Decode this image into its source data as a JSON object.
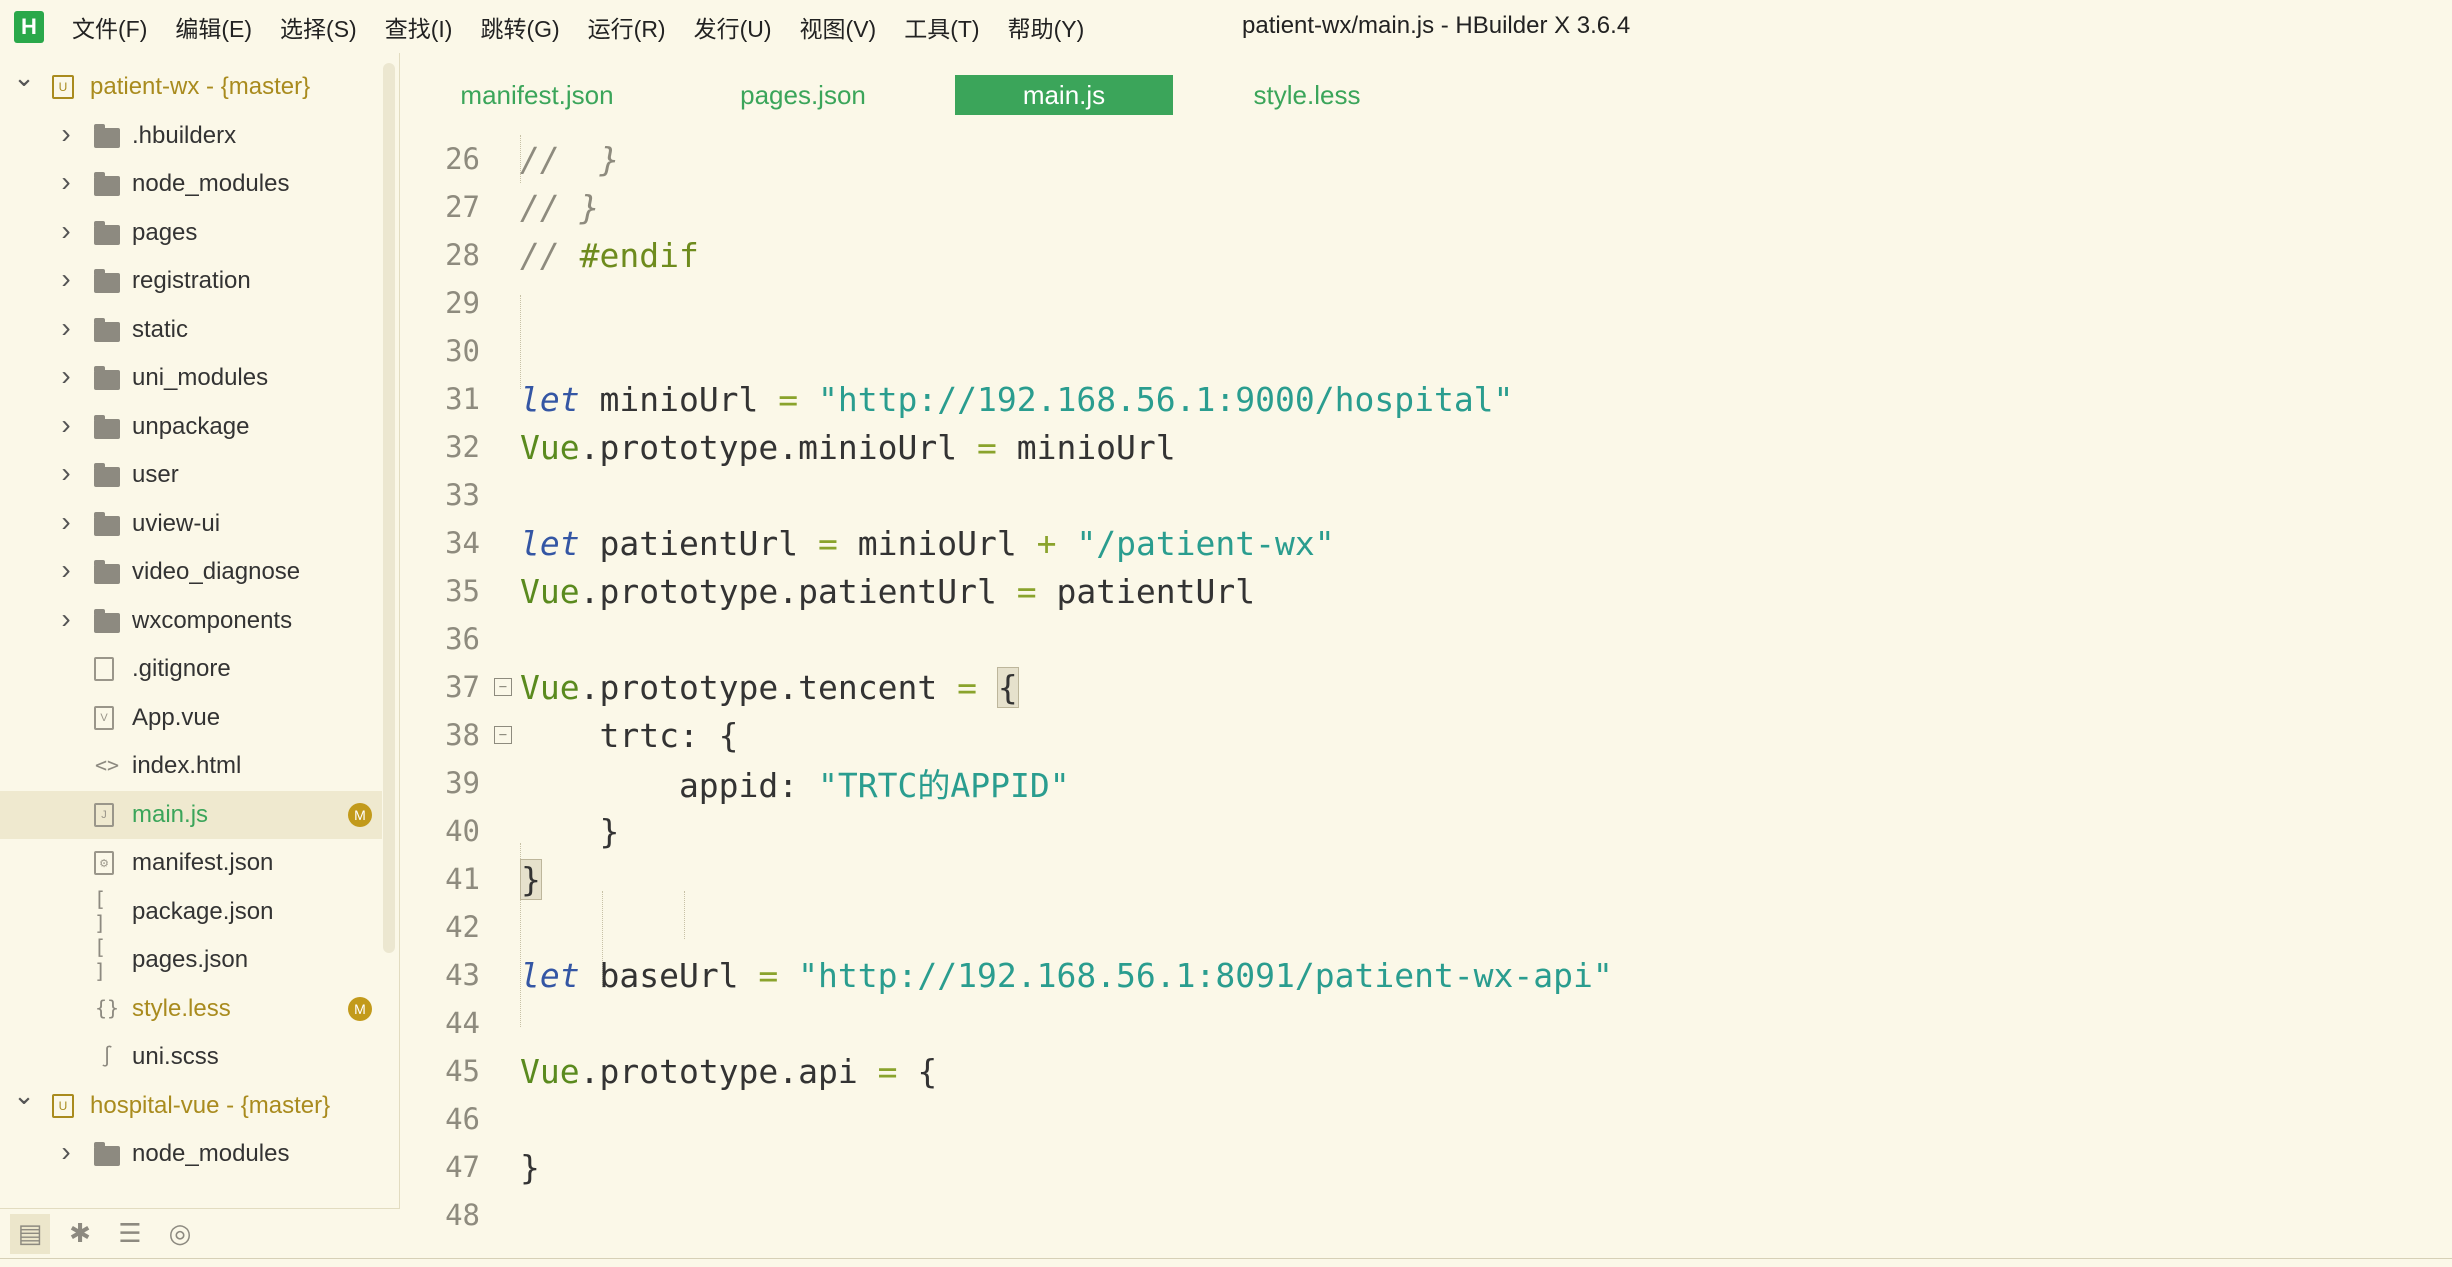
{
  "app": {
    "logo_letter": "H",
    "window_title": "patient-wx/main.js - HBuilder X 3.6.4"
  },
  "menu": [
    "文件(F)",
    "编辑(E)",
    "选择(S)",
    "查找(I)",
    "跳转(G)",
    "运行(R)",
    "发行(U)",
    "视图(V)",
    "工具(T)",
    "帮助(Y)"
  ],
  "sidebar": {
    "items": [
      {
        "label": "patient-wx - {master}",
        "kind": "project",
        "expanded": true
      },
      {
        "label": ".hbuilderx",
        "kind": "folder"
      },
      {
        "label": "node_modules",
        "kind": "folder"
      },
      {
        "label": "pages",
        "kind": "folder"
      },
      {
        "label": "registration",
        "kind": "folder"
      },
      {
        "label": "static",
        "kind": "folder"
      },
      {
        "label": "uni_modules",
        "kind": "folder"
      },
      {
        "label": "unpackage",
        "kind": "folder"
      },
      {
        "label": "user",
        "kind": "folder"
      },
      {
        "label": "uview-ui",
        "kind": "folder"
      },
      {
        "label": "video_diagnose",
        "kind": "folder"
      },
      {
        "label": "wxcomponents",
        "kind": "folder"
      },
      {
        "label": ".gitignore",
        "kind": "file",
        "icon": "blank-file-icon"
      },
      {
        "label": "App.vue",
        "kind": "file",
        "icon": "vue-file-icon"
      },
      {
        "label": "index.html",
        "kind": "file",
        "icon": "html-file-icon"
      },
      {
        "label": "main.js",
        "kind": "file",
        "icon": "js-file-icon",
        "badge": "M",
        "selected": true
      },
      {
        "label": "manifest.json",
        "kind": "file",
        "icon": "gear-file-icon"
      },
      {
        "label": "package.json",
        "kind": "file",
        "icon": "bracket-file-icon"
      },
      {
        "label": "pages.json",
        "kind": "file",
        "icon": "bracket-file-icon"
      },
      {
        "label": "style.less",
        "kind": "file",
        "icon": "braces-file-icon",
        "badge": "M"
      },
      {
        "label": "uni.scss",
        "kind": "file",
        "icon": "sass-file-icon"
      },
      {
        "label": "hospital-vue - {master}",
        "kind": "project",
        "expanded": true
      },
      {
        "label": "node_modules",
        "kind": "folder"
      }
    ]
  },
  "tabs": [
    {
      "label": "manifest.json",
      "active": false
    },
    {
      "label": "pages.json",
      "active": false
    },
    {
      "label": "main.js",
      "active": true
    },
    {
      "label": "style.less",
      "active": false
    }
  ],
  "editor": {
    "lines": [
      {
        "n": "26",
        "tokens": [
          [
            "comment",
            "//  }"
          ]
        ]
      },
      {
        "n": "27",
        "tokens": [
          [
            "comment",
            "// }"
          ]
        ]
      },
      {
        "n": "28",
        "tokens": [
          [
            "comment",
            "// "
          ],
          [
            "directive",
            "#endif"
          ]
        ]
      },
      {
        "n": "29",
        "tokens": []
      },
      {
        "n": "30",
        "tokens": []
      },
      {
        "n": "31",
        "tokens": [
          [
            "kw",
            "let"
          ],
          [
            "ident",
            " minioUrl "
          ],
          [
            "op",
            "="
          ],
          [
            "ident",
            " "
          ],
          [
            "str",
            "\"http://192.168.56.1:9000/hospital\""
          ]
        ]
      },
      {
        "n": "32",
        "tokens": [
          [
            "obj",
            "Vue"
          ],
          [
            "ident",
            ".prototype.minioUrl "
          ],
          [
            "op",
            "="
          ],
          [
            "ident",
            " minioUrl"
          ]
        ]
      },
      {
        "n": "33",
        "tokens": []
      },
      {
        "n": "34",
        "tokens": [
          [
            "kw",
            "let"
          ],
          [
            "ident",
            " patientUrl "
          ],
          [
            "op",
            "="
          ],
          [
            "ident",
            " minioUrl "
          ],
          [
            "op",
            "+"
          ],
          [
            "ident",
            " "
          ],
          [
            "str",
            "\"/patient-wx\""
          ]
        ]
      },
      {
        "n": "35",
        "tokens": [
          [
            "obj",
            "Vue"
          ],
          [
            "ident",
            ".prototype.patientUrl "
          ],
          [
            "op",
            "="
          ],
          [
            "ident",
            " patientUrl"
          ]
        ]
      },
      {
        "n": "36",
        "tokens": []
      },
      {
        "n": "37",
        "tokens": [
          [
            "obj",
            "Vue"
          ],
          [
            "ident",
            ".prototype.tencent "
          ],
          [
            "op",
            "="
          ],
          [
            "ident",
            " "
          ],
          [
            "bracehl",
            "{"
          ]
        ],
        "fold": true
      },
      {
        "n": "38",
        "tokens": [
          [
            "ident",
            "    trtc: {"
          ]
        ],
        "fold": true
      },
      {
        "n": "39",
        "tokens": [
          [
            "ident",
            "        appid: "
          ],
          [
            "str",
            "\"TRTC的APPID\""
          ]
        ]
      },
      {
        "n": "40",
        "tokens": [
          [
            "ident",
            "    }"
          ]
        ]
      },
      {
        "n": "41",
        "tokens": [
          [
            "bracehl",
            "}"
          ]
        ]
      },
      {
        "n": "42",
        "tokens": []
      },
      {
        "n": "43",
        "tokens": [
          [
            "kw",
            "let"
          ],
          [
            "ident",
            " baseUrl "
          ],
          [
            "op",
            "="
          ],
          [
            "ident",
            " "
          ],
          [
            "str",
            "\"http://192.168.56.1:8091/patient-wx-api\""
          ]
        ]
      },
      {
        "n": "44",
        "tokens": []
      },
      {
        "n": "45",
        "tokens": [
          [
            "obj",
            "Vue"
          ],
          [
            "ident",
            ".prototype.api "
          ],
          [
            "op",
            "="
          ],
          [
            "ident",
            " {"
          ]
        ]
      },
      {
        "n": "46",
        "tokens": []
      },
      {
        "n": "47",
        "tokens": [
          [
            "ident",
            "}"
          ]
        ]
      },
      {
        "n": "48",
        "tokens": []
      }
    ]
  },
  "bottom_toolbar": [
    "explorer-icon",
    "debug-icon",
    "search-list-icon",
    "globe-icon"
  ],
  "colors": {
    "background": "#fbf8e8",
    "accent_green": "#3ba55a",
    "project_gold": "#a98b1e",
    "badge": "#c29a1b"
  }
}
